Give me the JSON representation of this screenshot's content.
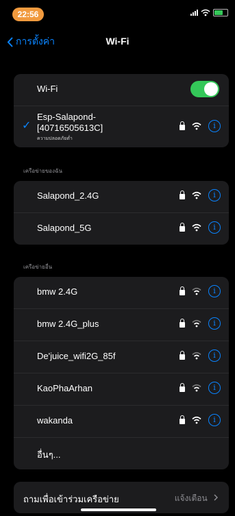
{
  "status": {
    "time": "22:56"
  },
  "nav": {
    "back_label": "การตั้งค่า",
    "title": "Wi-Fi"
  },
  "wifi_toggle": {
    "label": "Wi-Fi",
    "on": true
  },
  "connected": {
    "name_line1": "Esp-Salapond-",
    "name_line2": "[40716505613C]",
    "subtitle": "ความปลอดภัยต่ำ"
  },
  "my_networks": {
    "header": "เครือข่ายของฉัน",
    "items": [
      {
        "label": "Salapond_2.4G"
      },
      {
        "label": "Salapond_5G"
      }
    ]
  },
  "other_networks": {
    "header": "เครือข่ายอื่น",
    "items": [
      {
        "label": "bmw 2.4G"
      },
      {
        "label": "bmw 2.4G_plus"
      },
      {
        "label": "De'juice_wifi2G_85f"
      },
      {
        "label": "KaoPhaArhan"
      },
      {
        "label": "wakanda"
      }
    ],
    "other_label": "อื่นๆ..."
  },
  "ask_join": {
    "label": "ถามเพื่อเข้าร่วมเครือข่าย",
    "value": "แจ้งเตือน"
  },
  "colors": {
    "accent": "#0a84ff",
    "toggle_on": "#34c759",
    "time_pill": "#f19a3e"
  }
}
